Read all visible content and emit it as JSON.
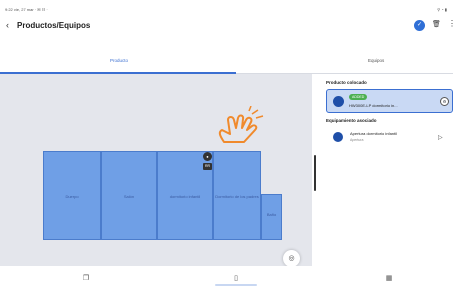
{
  "status_bar": {
    "left": "9:22 vie, 27 mar · ✉ ☷ ·",
    "right": "⚲ ◔ ▮"
  },
  "header": {
    "title": "Productos/Equipos",
    "back_icon": "arrow-back-icon",
    "actions": [
      "check-icon",
      "trash-icon",
      "more-vert-icon"
    ]
  },
  "tabs": [
    {
      "label": "Producto",
      "active": true
    },
    {
      "label": "Equipos",
      "active": false
    }
  ],
  "plan": {
    "rooms": [
      "Duerpo",
      "Salón",
      "dormitorio infantil",
      "Dormitorio de los padres",
      "Baño"
    ],
    "marker_tag": "RR"
  },
  "panel": {
    "product_section_title": "Producto colocado",
    "product": {
      "badge": "ADDED",
      "name": "HW300E-LP dormitorio in..."
    },
    "equipment_section_title": "Equipamiento asociado",
    "equipment": {
      "name": "Apertura dormitorio infantil",
      "sub": "Apertura"
    }
  },
  "bottom_nav": [
    {
      "icon": "devices-icon",
      "label": "",
      "active": false
    },
    {
      "icon": "floorplan-icon",
      "label": "",
      "active": true
    },
    {
      "icon": "grid-icon",
      "label": "",
      "active": false
    }
  ],
  "colors": {
    "accent": "#3b6fd1",
    "room_fill": "#6f9fe6",
    "canvas_bg": "#e4e6ec",
    "badge_green": "#4caf50"
  }
}
